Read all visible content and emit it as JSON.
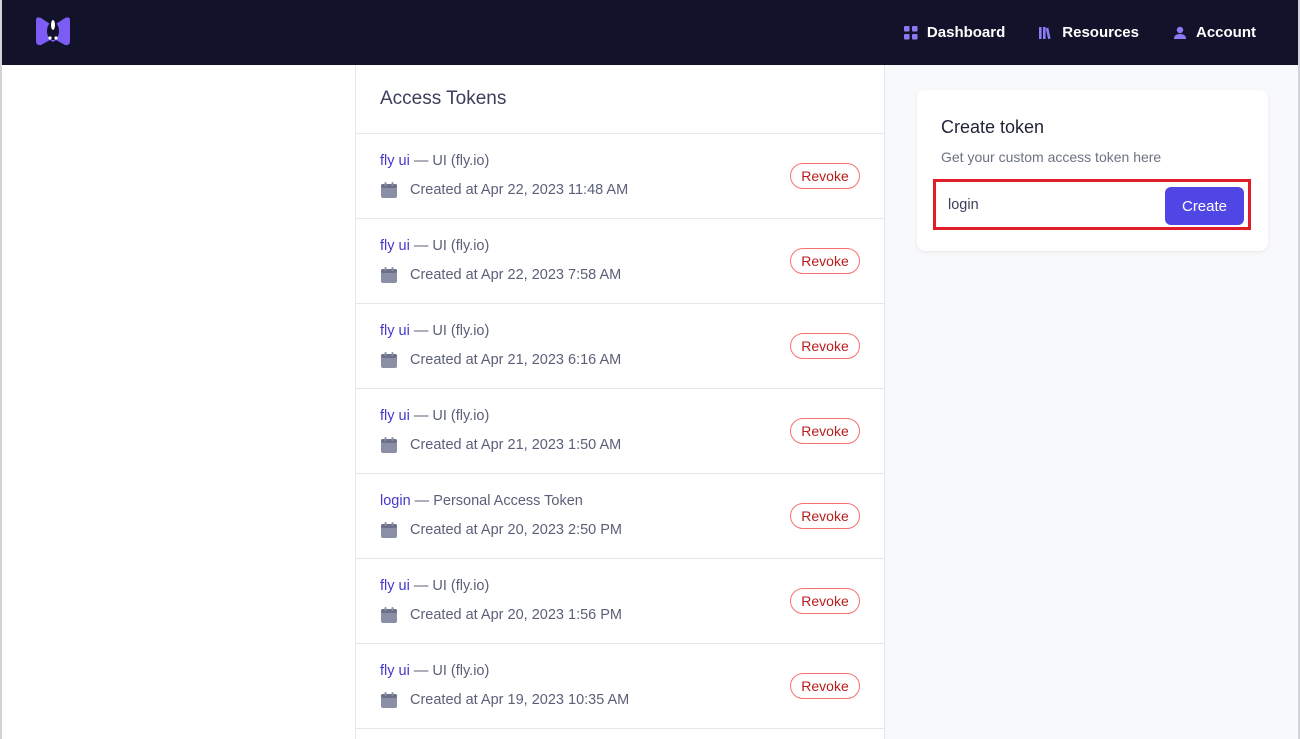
{
  "navbar": {
    "logo": "fly-badger-logo",
    "links": [
      {
        "label": "Dashboard",
        "icon": "grid-icon"
      },
      {
        "label": "Resources",
        "icon": "library-icon"
      },
      {
        "label": "Account",
        "icon": "user-icon"
      }
    ],
    "background": "#12132a",
    "accent": "#7c5cf5"
  },
  "tokens": {
    "title": "Access Tokens",
    "revoke_label": "Revoke",
    "separator": "—",
    "items": [
      {
        "name": "fly ui",
        "type": "UI (fly.io)",
        "created": "Created at Apr 22, 2023 11:48 AM"
      },
      {
        "name": "fly ui",
        "type": "UI (fly.io)",
        "created": "Created at Apr 22, 2023 7:58 AM"
      },
      {
        "name": "fly ui",
        "type": "UI (fly.io)",
        "created": "Created at Apr 21, 2023 6:16 AM"
      },
      {
        "name": "fly ui",
        "type": "UI (fly.io)",
        "created": "Created at Apr 21, 2023 1:50 AM"
      },
      {
        "name": "login",
        "type": "Personal Access Token",
        "created": "Created at Apr 20, 2023 2:50 PM"
      },
      {
        "name": "fly ui",
        "type": "UI (fly.io)",
        "created": "Created at Apr 20, 2023 1:56 PM"
      },
      {
        "name": "fly ui",
        "type": "UI (fly.io)",
        "created": "Created at Apr 19, 2023 10:35 AM"
      }
    ]
  },
  "create_token": {
    "title": "Create token",
    "subtitle": "Get your custom access token here",
    "input_value": "login",
    "button_label": "Create",
    "button_color": "#4f46e5",
    "highlight_color": "#e11d2a"
  }
}
